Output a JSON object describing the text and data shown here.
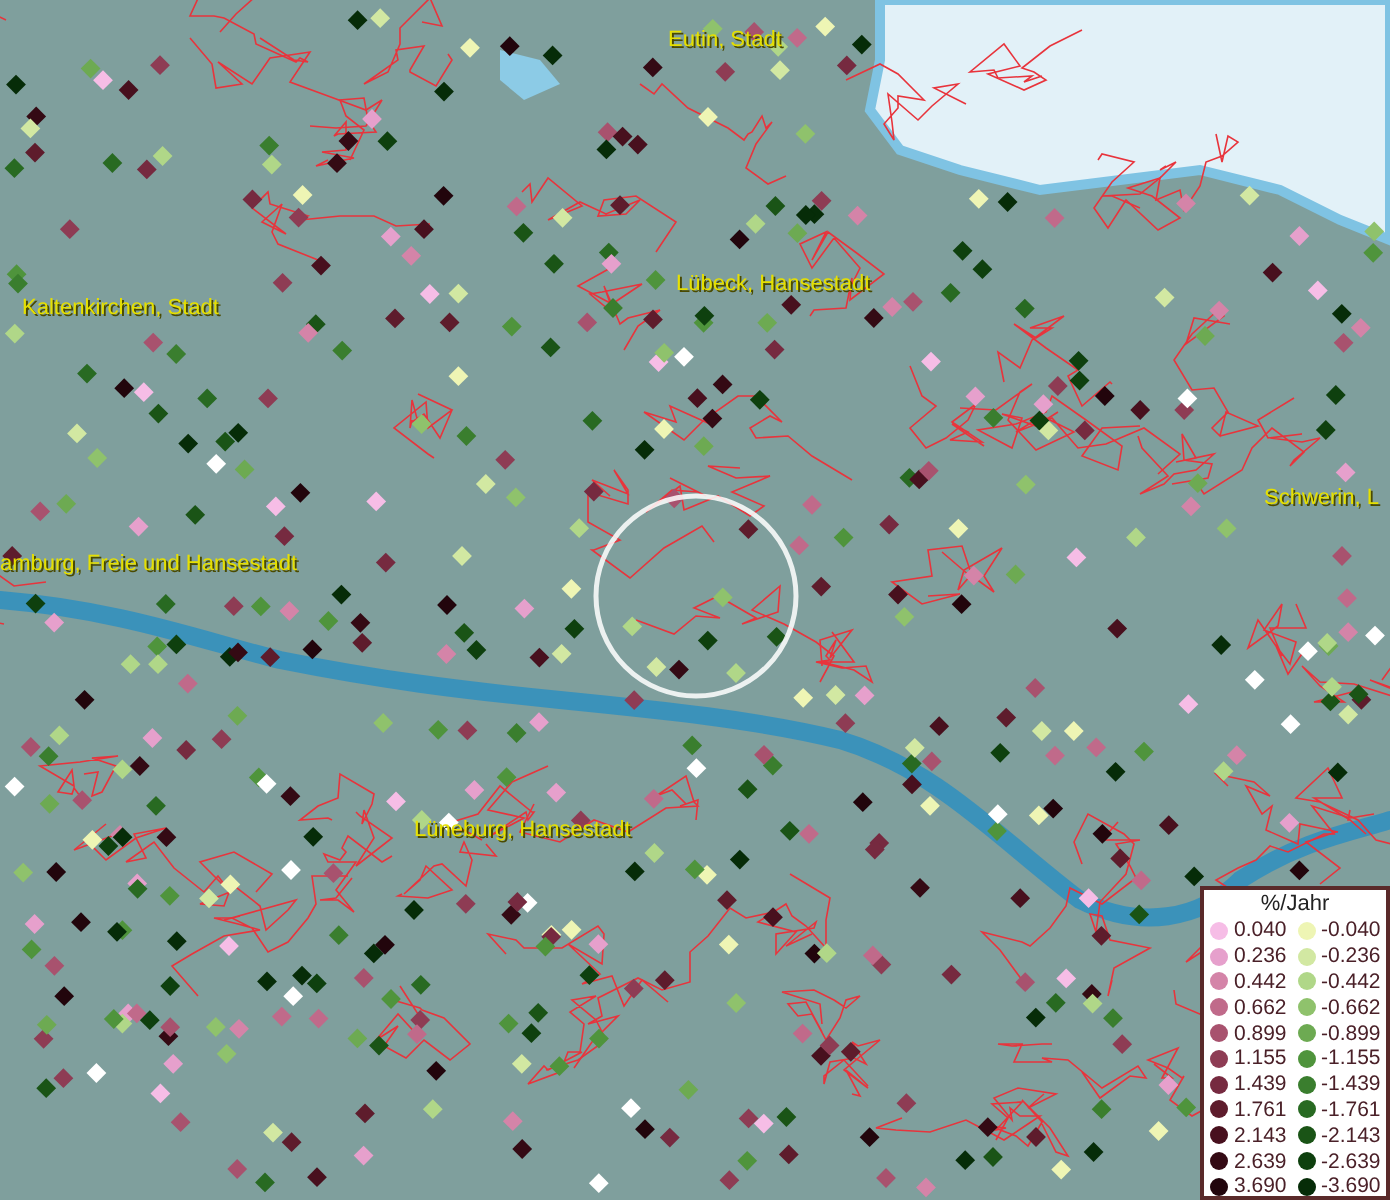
{
  "map": {
    "place_labels": [
      "Eutin, Stadt",
      "Kaltenkirchen, Stadt",
      "Lübeck, Hansestadt",
      "amburg, Freie und Hansestadt",
      "Schwerin, L",
      "Lüneburg, Hansestadt"
    ]
  },
  "legend": {
    "title": "%/Jahr",
    "entries": [
      {
        "label": "0.040",
        "color": "#f6bde6"
      },
      {
        "label": "-0.040",
        "color": "#eef5b4"
      },
      {
        "label": "0.236",
        "color": "#e6a0cc"
      },
      {
        "label": "-0.236",
        "color": "#d2e8a2"
      },
      {
        "label": "0.442",
        "color": "#d484a8"
      },
      {
        "label": "-0.442",
        "color": "#b0d788"
      },
      {
        "label": "0.662",
        "color": "#c06a8a"
      },
      {
        "label": "-0.662",
        "color": "#8fc26c"
      },
      {
        "label": "0.899",
        "color": "#a8526e"
      },
      {
        "label": "-0.899",
        "color": "#6daa52"
      },
      {
        "label": "1.155",
        "color": "#8e3c54"
      },
      {
        "label": "-1.155",
        "color": "#4f943c"
      },
      {
        "label": "1.439",
        "color": "#762a40"
      },
      {
        "label": "-1.439",
        "color": "#3a7e2e"
      },
      {
        "label": "1.761",
        "color": "#5e1c2c"
      },
      {
        "label": "-1.761",
        "color": "#286a22"
      },
      {
        "label": "2.143",
        "color": "#48101e"
      },
      {
        "label": "-2.143",
        "color": "#1a5416"
      },
      {
        "label": "2.639",
        "color": "#340a14"
      },
      {
        "label": "-2.639",
        "color": "#0e400e"
      },
      {
        "label": "3.690",
        "color": "#22050c"
      },
      {
        "label": "-3.690",
        "color": "#062c08"
      }
    ]
  }
}
